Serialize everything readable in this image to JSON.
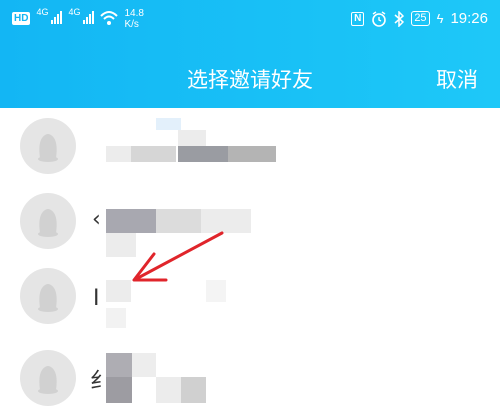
{
  "status_bar": {
    "hd_badge": "HD",
    "sim1": "4G",
    "sim2": "4G",
    "speed_value": "14.8",
    "speed_unit": "K/s",
    "nfc": "N",
    "battery": "25",
    "time": "19:26"
  },
  "header": {
    "title": "选择邀请好友",
    "cancel_label": "取消"
  },
  "contacts": [
    {
      "name_visible": ""
    },
    {
      "name_visible": "‹"
    },
    {
      "name_visible": "I"
    },
    {
      "name_visible": "纟"
    }
  ],
  "colors": {
    "header_bg": "#16bdf5",
    "arrow": "#e0252b"
  }
}
